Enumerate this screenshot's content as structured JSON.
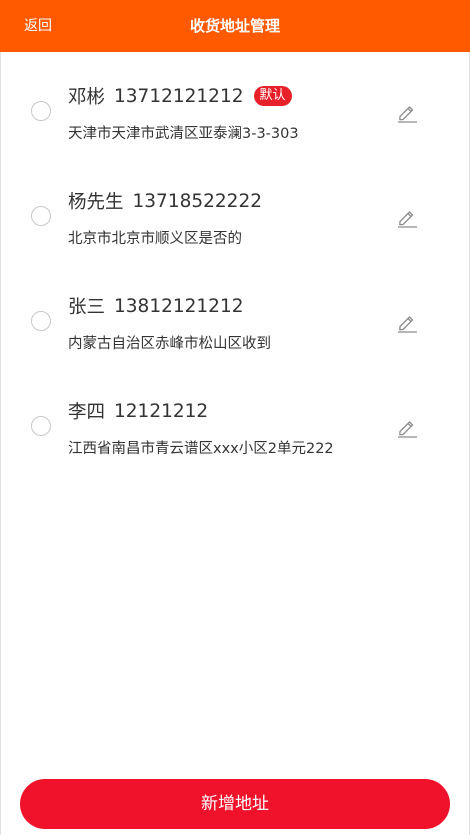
{
  "header": {
    "back_label": "返回",
    "title": "收货地址管理",
    "color": "#ff5a00"
  },
  "addresses": [
    {
      "name": "邓彬",
      "phone": "13712121212",
      "badge": "默认",
      "address": "天津市天津市武清区亚泰澜3-3-303",
      "selected": false,
      "edit_icon": "pencil-icon"
    },
    {
      "name": "杨先生",
      "phone": "13718522222",
      "address": "北京市北京市顺义区是否的",
      "selected": false,
      "edit_icon": "pencil-icon"
    },
    {
      "name": "张三",
      "phone": "13812121212",
      "address": "内蒙古自治区赤峰市松山区收到",
      "selected": false,
      "edit_icon": "pencil-icon"
    },
    {
      "name": "李四",
      "phone": "12121212",
      "address": "江西省南昌市青云谱区xxx小区2单元222",
      "selected": false,
      "edit_icon": "pencil-icon"
    }
  ],
  "footer": {
    "add_label": "新增地址",
    "color": "#f0112a"
  },
  "colors": {
    "badge": "#e8202a"
  }
}
